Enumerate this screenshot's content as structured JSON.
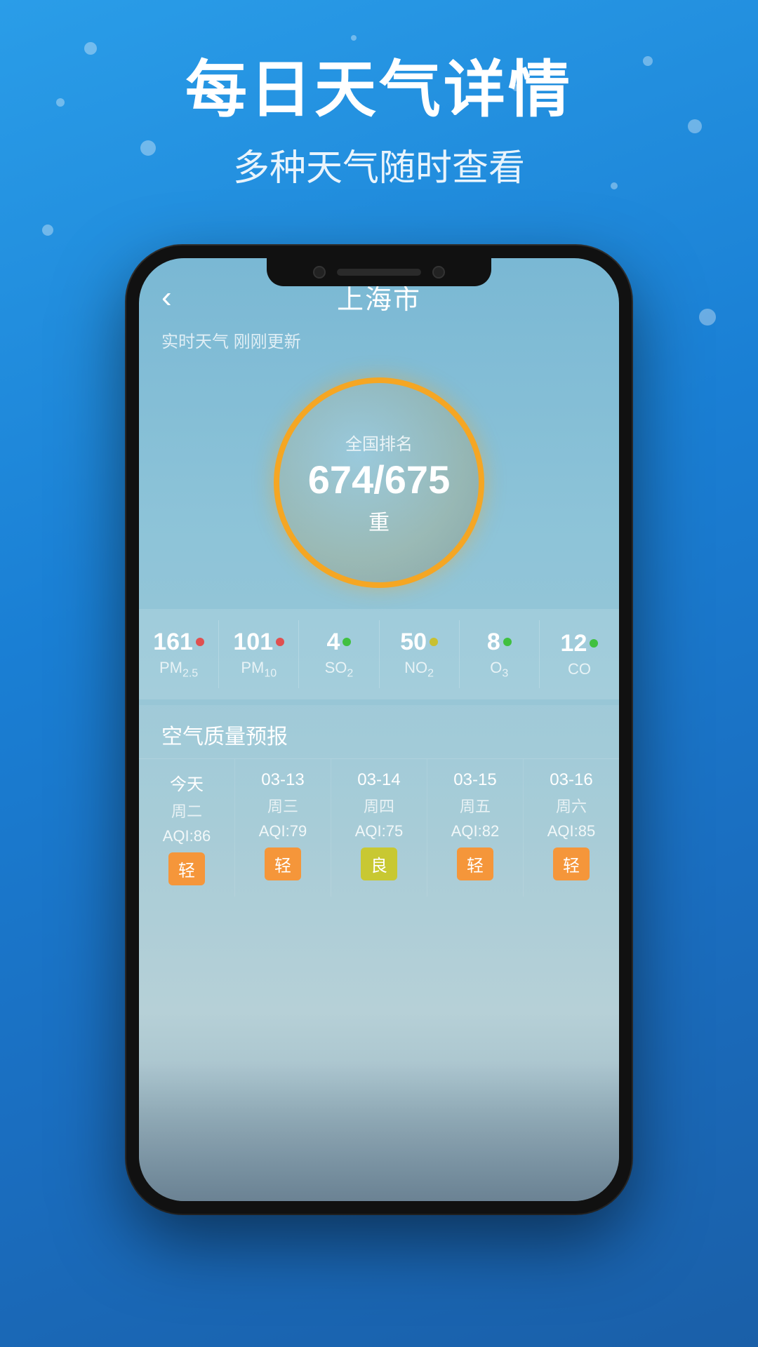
{
  "background": {
    "color_top": "#2a9de8",
    "color_bottom": "#1a5fa8"
  },
  "header": {
    "main_title": "每日天气详情",
    "sub_title": "多种天气随时查看"
  },
  "nav": {
    "back_label": "‹",
    "city_title": "上海市"
  },
  "status": {
    "text": "实时天气 刚刚更新"
  },
  "aqi_circle": {
    "label": "全国排名",
    "value": "674/675",
    "level": "重"
  },
  "metrics": [
    {
      "value": "161",
      "dot_color": "#e05050",
      "name": "PM",
      "sub": "2.5"
    },
    {
      "value": "101",
      "dot_color": "#e05050",
      "name": "PM",
      "sub": "10"
    },
    {
      "value": "4",
      "dot_color": "#40c040",
      "name": "SO",
      "sub": "2"
    },
    {
      "value": "50",
      "dot_color": "#c8c032",
      "name": "NO",
      "sub": "2"
    },
    {
      "value": "8",
      "dot_color": "#40c040",
      "name": "O",
      "sub": "3"
    },
    {
      "value": "12",
      "dot_color": "#40c040",
      "name": "CO",
      "sub": ""
    }
  ],
  "forecast": {
    "section_title": "空气质量预报",
    "columns": [
      {
        "date": "今天",
        "day": "周二",
        "aqi": "AQI:86",
        "badge": "轻",
        "badge_class": "badge-light"
      },
      {
        "date": "03-13",
        "day": "周三",
        "aqi": "AQI:79",
        "badge": "轻",
        "badge_class": "badge-light"
      },
      {
        "date": "03-14",
        "day": "周四",
        "aqi": "AQI:75",
        "badge": "良",
        "badge_class": "badge-good"
      },
      {
        "date": "03-15",
        "day": "周五",
        "aqi": "AQI:82",
        "badge": "轻",
        "badge_class": "badge-light"
      },
      {
        "date": "03-16",
        "day": "周六",
        "aqi": "AQI:85",
        "badge": "轻",
        "badge_class": "badge-light"
      }
    ]
  }
}
